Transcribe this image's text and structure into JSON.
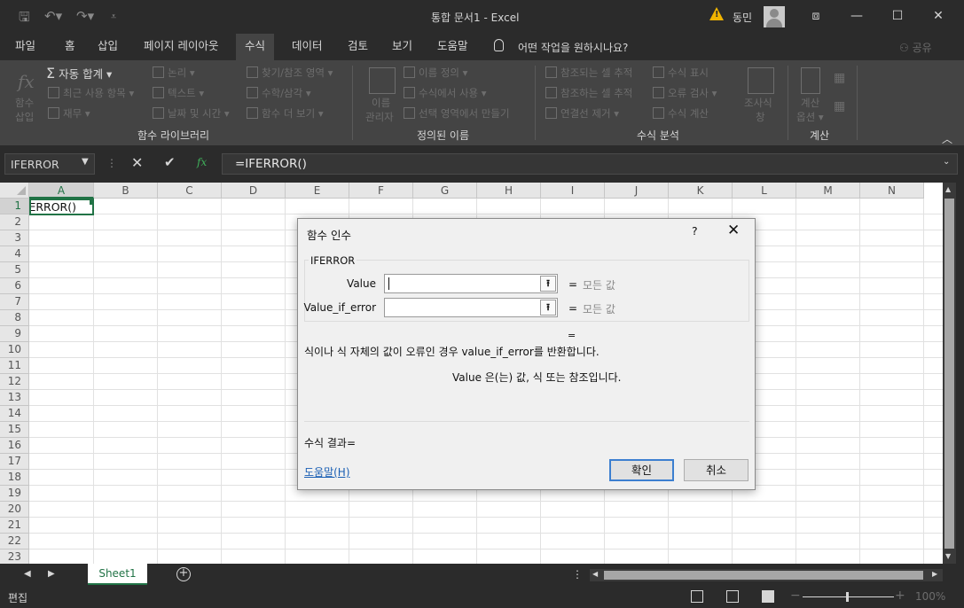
{
  "titlebar": {
    "title": "통합 문서1",
    "app": "Excel",
    "separator": "-",
    "user": "동민",
    "warning_icon": "warning-icon",
    "quick_access": [
      "save-icon",
      "undo-icon",
      "redo-icon",
      "customize-icon"
    ],
    "window_buttons": {
      "ribbon_display": "⧈",
      "minimize": "—",
      "maximize": "☐",
      "close": "✕"
    }
  },
  "tabs": [
    {
      "label": "파일"
    },
    {
      "label": "홈"
    },
    {
      "label": "삽입"
    },
    {
      "label": "페이지 레이아웃"
    },
    {
      "label": "수식",
      "active": true
    },
    {
      "label": "데이터"
    },
    {
      "label": "검토"
    },
    {
      "label": "보기"
    },
    {
      "label": "도움말"
    }
  ],
  "tellme": "어떤 작업을 원하시나요?",
  "share": "공유",
  "ribbon": {
    "function_library": {
      "label": "함수 라이브러리",
      "insert_function": [
        "함수",
        "삽입"
      ],
      "autosum": "자동 합계",
      "recent": "최근 사용 항목",
      "financial": "재무",
      "logical": "논리",
      "text": "텍스트",
      "datetime": "날짜 및 시간",
      "lookup": "찾기/참조 영역",
      "math": "수학/삼각",
      "more": "함수 더 보기"
    },
    "defined_names": {
      "label": "정의된 이름",
      "name_manager": [
        "이름",
        "관리자"
      ],
      "define_name": "이름 정의",
      "use_in_formula": "수식에서 사용",
      "create_from_selection": "선택 영역에서 만들기"
    },
    "formula_auditing": {
      "label": "수식 분석",
      "trace_precedents": "참조되는 셀 추적",
      "trace_dependents": "참조하는 셀 추적",
      "remove_arrows": "연결선 제거",
      "show_formulas": "수식 표시",
      "error_checking": "오류 검사",
      "evaluate_formula": "수식 계산",
      "watch_window": [
        "조사식",
        "창"
      ]
    },
    "calculation": {
      "label": "계산",
      "options": [
        "계산",
        "옵션"
      ]
    }
  },
  "formula_bar": {
    "name_box": "IFERROR",
    "formula": "=IFERROR()",
    "fx": "fx"
  },
  "grid": {
    "columns": [
      "A",
      "B",
      "C",
      "D",
      "E",
      "F",
      "G",
      "H",
      "I",
      "J",
      "K",
      "L",
      "M",
      "N"
    ],
    "rows": [
      "1",
      "2",
      "3",
      "4",
      "5",
      "6",
      "7",
      "8",
      "9",
      "10",
      "11",
      "12",
      "13",
      "14",
      "15",
      "16",
      "17",
      "18",
      "19",
      "20",
      "21",
      "22",
      "23"
    ],
    "active_cell_text": "=IFERROR()"
  },
  "sheets": [
    {
      "label": "Sheet1",
      "active": true
    }
  ],
  "status": {
    "mode": "편집",
    "zoom": "100%"
  },
  "dialog": {
    "title": "함수 인수",
    "help_btn": "?",
    "close_btn": "✕",
    "function_name": "IFERROR",
    "args": [
      {
        "label": "Value",
        "value": "",
        "result": "모든 값"
      },
      {
        "label": "Value_if_error",
        "value": "",
        "result": "모든 값"
      }
    ],
    "eq": "=",
    "description": "식이나 식 자체의 값이 오류인 경우 value_if_error를 반환합니다.",
    "arg_description": "Value  은(는) 값, 식 또는 참조입니다.",
    "result_label": "수식 결과=",
    "help_link": "도움말(H)",
    "ok": "확인",
    "cancel": "취소"
  },
  "colors": {
    "accent": "#217346",
    "dark_bg": "#2b2b2b",
    "ribbon_bg": "#444444",
    "link": "#1a5fb4",
    "warning": "#f0b400"
  }
}
